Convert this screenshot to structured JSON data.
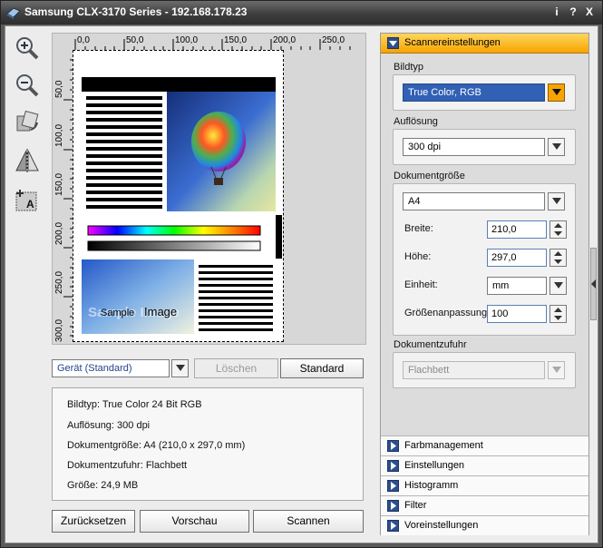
{
  "window": {
    "title": "Samsung CLX-3170 Series - 192.168.178.23",
    "info_btn": "i",
    "help_btn": "?",
    "close_btn": "X"
  },
  "preview": {
    "ruler_h": [
      "0,0",
      "50,0",
      "100,0",
      "150,0",
      "200,0",
      "250,0"
    ],
    "ruler_v": [
      "50,0",
      "100,0",
      "150,0",
      "200,0",
      "250,0",
      "300,0"
    ],
    "sample_text_1": "Sample",
    "sample_text_2": "Image"
  },
  "device_select": {
    "value": "Gerät (Standard)"
  },
  "buttons": {
    "delete": "Löschen",
    "standard": "Standard",
    "reset": "Zurücksetzen",
    "preview": "Vorschau",
    "scan": "Scannen"
  },
  "info": {
    "lines": [
      "Bildtyp: True Color 24 Bit RGB",
      "Auflösung: 300 dpi",
      "Dokumentgröße: A4 (210,0 x 297,0 mm)",
      "Dokumentzufuhr: Flachbett",
      "Größe: 24,9 MB"
    ]
  },
  "panel": {
    "scanner_settings": "Scannereinstellungen",
    "bildtyp_label": "Bildtyp",
    "bildtyp_value": "True Color, RGB",
    "aufloesung_label": "Auflösung",
    "aufloesung_value": "300 dpi",
    "dokumentgroesse_label": "Dokumentgröße",
    "dokumentgroesse_value": "A4",
    "breite_label": "Breite:",
    "breite_value": "210,0",
    "hoehe_label": "Höhe:",
    "hoehe_value": "297,0",
    "einheit_label": "Einheit:",
    "einheit_value": "mm",
    "groessenanpassung_label": "Größenanpassung",
    "groessenanpassung_value": "100",
    "dokumentzufuhr_label": "Dokumentzufuhr",
    "dokumentzufuhr_value": "Flachbett",
    "sections": [
      "Farbmanagement",
      "Einstellungen",
      "Histogramm",
      "Filter",
      "Voreinstellungen"
    ]
  },
  "colors": {
    "accent_orange": "#f7a400",
    "accent_blue": "#2d4f8e",
    "highlight_blue": "#3160b5"
  }
}
